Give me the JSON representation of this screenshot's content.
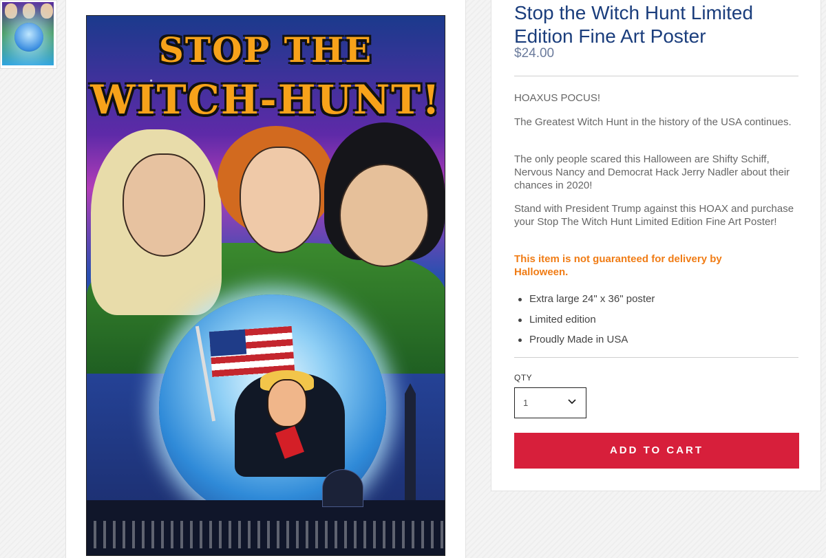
{
  "product": {
    "title": "Stop the Witch Hunt Limited Edition Fine Art Poster",
    "price": "$24.00",
    "description": [
      "HOAXUS POCUS!",
      "The Greatest Witch Hunt in the history of the USA continues.",
      "The only people scared this Halloween are Shifty Schiff, Nervous Nancy and Democrat Hack Jerry Nadler about their chances in 2020!",
      "Stand with President Trump against this HOAX and purchase your Stop The Witch Hunt Limited Edition Fine Art Poster!"
    ],
    "warning": "This item is not guaranteed for delivery by Halloween.",
    "features": [
      "Extra large 24\" x 36\" poster",
      "Limited edition",
      "Proudly Made in USA"
    ]
  },
  "quantity": {
    "label": "QTY",
    "value": "1"
  },
  "cart": {
    "button_label": "ADD TO CART"
  },
  "poster": {
    "title_line1": "STOP THE",
    "title_line2": "WITCH-HUNT!"
  },
  "colors": {
    "title": "#1a3d7c",
    "price": "#6b7b9c",
    "warning": "#f07c15",
    "cart_button": "#d71f3b"
  }
}
